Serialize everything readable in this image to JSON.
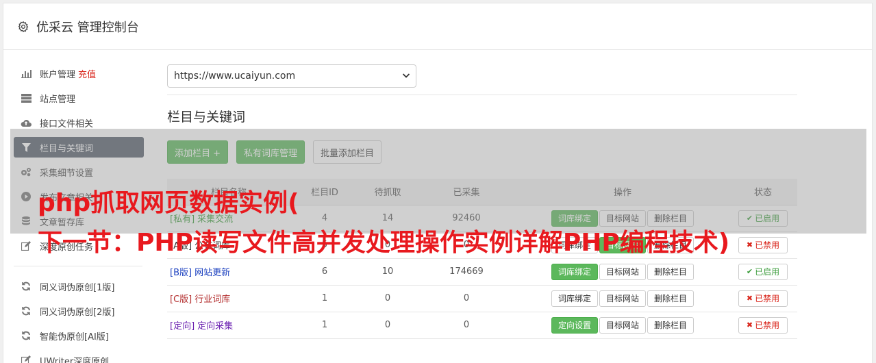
{
  "header": {
    "title": "优采云 管理控制台",
    "icon": "gear-icon"
  },
  "sidebar": {
    "items": [
      {
        "label": "账户管理",
        "extra": "充值",
        "icon": "bar-chart-icon"
      },
      {
        "label": "站点管理",
        "icon": "server-icon"
      },
      {
        "label": "接口文件相关",
        "icon": "cloud-upload-icon"
      },
      {
        "label": "栏目与关键词",
        "icon": "filter-icon",
        "active": true
      },
      {
        "label": "采集细节设置",
        "icon": "cogs-icon"
      },
      {
        "label": "发布文章相关",
        "icon": "play-circle-icon"
      },
      {
        "label": "文章暂存库",
        "icon": "database-icon"
      },
      {
        "label": "深度原创任务",
        "icon": "edit-icon"
      }
    ],
    "items2": [
      {
        "label": "同义词伪原创[1版]",
        "icon": "refresh-icon"
      },
      {
        "label": "同义词伪原创[2版]",
        "icon": "refresh-icon"
      },
      {
        "label": "智能伪原创[AI版]",
        "icon": "refresh-icon"
      },
      {
        "label": "UWriter深度原创",
        "icon": "edit-icon"
      }
    ]
  },
  "main": {
    "site_select": "https://www.ucaiyun.com",
    "section_title": "栏目与关键词",
    "buttons": {
      "add": "添加栏目 +",
      "private": "私有词库管理",
      "batch": "批量添加栏目"
    },
    "table": {
      "headers": [
        "栏目名称",
        "栏目ID",
        "待抓取",
        "已采集",
        "操作",
        "状态"
      ],
      "rows": [
        {
          "tag": "[私有]",
          "name": "采集交流",
          "tag_color": "#3c9d3c",
          "id": "4",
          "pending": "14",
          "collected": "92460",
          "op1": "词库绑定",
          "op1_green": true,
          "op2": "目标网站",
          "op2_green": false,
          "op3": "删除栏目",
          "status": "已启用",
          "enabled": true
        },
        {
          "tag": "[A版]",
          "name": "公有词库",
          "tag_color": "#333333",
          "id": "5",
          "pending": "0",
          "collected": "0",
          "op1": "词库绑定",
          "op1_green": false,
          "op2": "目标网站",
          "op2_green": true,
          "op3": "删除栏目",
          "status": "已禁用",
          "enabled": false
        },
        {
          "tag": "[B版]",
          "name": "网站更新",
          "tag_color": "#1a3fbf",
          "id": "6",
          "pending": "10",
          "collected": "174669",
          "op1": "词库绑定",
          "op1_green": true,
          "op2": "目标网站",
          "op2_green": false,
          "op3": "删除栏目",
          "status": "已启用",
          "enabled": true
        },
        {
          "tag": "[C版]",
          "name": "行业词库",
          "tag_color": "#b32d2d",
          "id": "1",
          "pending": "0",
          "collected": "0",
          "op1": "词库绑定",
          "op1_green": false,
          "op2": "目标网站",
          "op2_green": false,
          "op3": "删除栏目",
          "status": "已禁用",
          "enabled": false
        },
        {
          "tag": "[定向]",
          "name": "定向采集",
          "tag_color": "#6a1fb0",
          "id": "1",
          "pending": "0",
          "collected": "0",
          "op1": "定向设置",
          "op1_green": true,
          "op2": "目标网站",
          "op2_green": false,
          "op3": "删除栏目",
          "status": "已禁用",
          "enabled": false
        }
      ]
    }
  },
  "watermark": {
    "line1": "php抓取网页数据实例(",
    "line2": "下一节：PHP读写文件高并发处理操作实例详解PHP编程技术)"
  },
  "colors": {
    "active_nav": "#555d6b",
    "green": "#5cb85c",
    "red": "#d9241a",
    "overlay_text": "#e8191e"
  }
}
